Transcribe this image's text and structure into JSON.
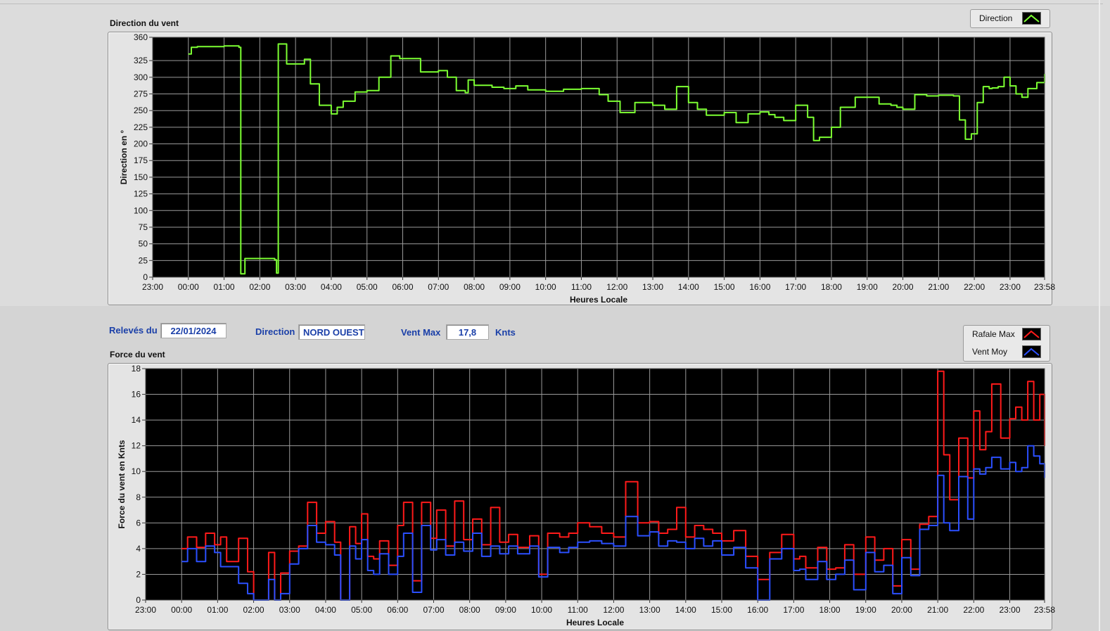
{
  "direction_panel": {
    "title": "Direction du vent",
    "legend": [
      {
        "label": "Direction",
        "color": "#7cff32"
      }
    ]
  },
  "controls": {
    "date_label": "Relevés du",
    "date_value": "22/01/2024",
    "direction_label": "Direction",
    "direction_value": "NORD OUEST",
    "vmax_label": "Vent Max",
    "vmax_value": "17,8",
    "vmax_unit": "Knts"
  },
  "force_panel": {
    "title": "Force du vent",
    "legend": [
      {
        "label": "Rafale Max",
        "color": "#ff1a1a"
      },
      {
        "label": "Vent Moy",
        "color": "#2b4fff"
      }
    ]
  },
  "chart_data": [
    {
      "type": "line",
      "title": "",
      "xlabel": "Heures Locale",
      "ylabel": "Direction en °",
      "x_ticks": [
        "23:00",
        "00:00",
        "01:00",
        "02:00",
        "03:00",
        "04:00",
        "05:00",
        "06:00",
        "07:00",
        "08:00",
        "09:00",
        "10:00",
        "11:00",
        "12:00",
        "13:00",
        "14:00",
        "15:00",
        "16:00",
        "17:00",
        "18:00",
        "19:00",
        "20:00",
        "21:00",
        "22:00",
        "23:00",
        "23:58"
      ],
      "y_ticks": [
        0,
        25,
        50,
        75,
        100,
        125,
        150,
        175,
        200,
        225,
        250,
        275,
        300,
        325,
        360
      ],
      "ylim": [
        0,
        360
      ],
      "grid": true,
      "legend_position": "top-right",
      "series": [
        {
          "name": "Direction",
          "color": "#7cff32",
          "x": [
            "00:00",
            "00:05",
            "00:15",
            "01:00",
            "01:25",
            "01:28",
            "01:35",
            "02:25",
            "02:28",
            "02:31",
            "02:45",
            "03:10",
            "03:15",
            "03:25",
            "03:40",
            "04:00",
            "04:10",
            "04:20",
            "04:40",
            "05:00",
            "05:15",
            "05:20",
            "05:40",
            "05:55",
            "06:30",
            "07:00",
            "07:15",
            "07:30",
            "07:45",
            "07:50",
            "08:00",
            "08:30",
            "08:50",
            "09:10",
            "09:30",
            "10:00",
            "10:30",
            "11:00",
            "11:30",
            "11:45",
            "12:05",
            "12:30",
            "13:00",
            "13:20",
            "13:40",
            "14:00",
            "14:15",
            "14:30",
            "15:00",
            "15:20",
            "15:40",
            "16:00",
            "16:15",
            "16:25",
            "16:40",
            "17:00",
            "17:15",
            "17:20",
            "17:30",
            "17:40",
            "17:45",
            "17:55",
            "18:00",
            "18:15",
            "18:40",
            "19:20",
            "19:30",
            "19:40",
            "19:50",
            "20:00",
            "20:20",
            "20:40",
            "21:00",
            "21:20",
            "21:25",
            "21:35",
            "21:45",
            "21:55",
            "22:05",
            "22:15",
            "22:25",
            "22:30",
            "22:40",
            "22:50",
            "23:00",
            "23:10",
            "23:20",
            "23:30",
            "23:45",
            "23:58"
          ],
          "values": [
            335,
            345,
            346,
            347,
            345,
            5,
            28,
            26,
            6,
            350,
            320,
            320,
            327,
            290,
            258,
            245,
            255,
            264,
            278,
            280,
            280,
            300,
            332,
            328,
            308,
            310,
            300,
            280,
            277,
            296,
            288,
            285,
            283,
            287,
            281,
            279,
            282,
            283,
            274,
            264,
            247,
            262,
            258,
            252,
            286,
            262,
            252,
            243,
            247,
            232,
            245,
            248,
            244,
            240,
            235,
            258,
            258,
            240,
            205,
            210,
            210,
            210,
            225,
            255,
            270,
            260,
            260,
            258,
            255,
            252,
            274,
            272,
            273,
            273,
            272,
            236,
            207,
            215,
            262,
            286,
            283,
            284,
            286,
            300,
            287,
            275,
            270,
            283,
            292,
            305
          ]
        }
      ]
    },
    {
      "type": "line",
      "title": "",
      "xlabel": "Heures Locale",
      "ylabel": "Force du vent en Knts",
      "x_ticks": [
        "23:00",
        "00:00",
        "01:00",
        "02:00",
        "03:00",
        "04:00",
        "05:00",
        "06:00",
        "07:00",
        "08:00",
        "09:00",
        "10:00",
        "11:00",
        "12:00",
        "13:00",
        "14:00",
        "15:00",
        "16:00",
        "17:00",
        "18:00",
        "19:00",
        "20:00",
        "21:00",
        "22:00",
        "23:00",
        "23:58"
      ],
      "y_ticks": [
        0,
        2,
        4,
        6,
        8,
        10,
        12,
        14,
        16,
        18
      ],
      "ylim": [
        0,
        18
      ],
      "grid": true,
      "legend_position": "top-right",
      "series": [
        {
          "name": "Rafale Max",
          "color": "#ff1a1a",
          "x": [
            "00:00",
            "00:10",
            "00:25",
            "00:40",
            "00:55",
            "01:05",
            "01:15",
            "01:35",
            "01:50",
            "02:00",
            "02:10",
            "02:25",
            "02:35",
            "02:45",
            "03:00",
            "03:15",
            "03:30",
            "03:45",
            "04:00",
            "04:15",
            "04:25",
            "04:40",
            "04:50",
            "05:00",
            "05:10",
            "05:20",
            "05:30",
            "05:45",
            "06:00",
            "06:10",
            "06:25",
            "06:40",
            "06:55",
            "07:05",
            "07:20",
            "07:35",
            "07:50",
            "08:05",
            "08:20",
            "08:35",
            "08:50",
            "09:05",
            "09:20",
            "09:40",
            "09:55",
            "10:10",
            "10:30",
            "10:45",
            "11:00",
            "11:20",
            "11:40",
            "12:00",
            "12:20",
            "12:40",
            "13:00",
            "13:15",
            "13:30",
            "13:45",
            "14:00",
            "14:15",
            "14:30",
            "14:45",
            "15:00",
            "15:20",
            "15:40",
            "16:00",
            "16:20",
            "16:40",
            "17:00",
            "17:10",
            "17:20",
            "17:40",
            "17:55",
            "18:10",
            "18:25",
            "18:40",
            "19:00",
            "19:15",
            "19:30",
            "19:45",
            "20:00",
            "20:15",
            "20:30",
            "20:45",
            "21:00",
            "21:10",
            "21:20",
            "21:35",
            "21:50",
            "22:00",
            "22:10",
            "22:20",
            "22:30",
            "22:45",
            "23:00",
            "23:10",
            "23:20",
            "23:30",
            "23:40",
            "23:50",
            "23:58"
          ],
          "values": [
            4.0,
            4.9,
            4.1,
            5.2,
            4.3,
            4.9,
            3.0,
            4.8,
            2.2,
            0.0,
            0.0,
            3.7,
            0.0,
            2.1,
            3.8,
            4.2,
            7.6,
            5.2,
            6.1,
            4.5,
            0.0,
            5.7,
            4.4,
            6.7,
            3.4,
            3.2,
            4.6,
            2.7,
            5.8,
            7.6,
            1.5,
            7.6,
            4.8,
            7.0,
            4.2,
            7.7,
            4.7,
            6.3,
            4.3,
            7.2,
            4.5,
            5.1,
            4.1,
            5.0,
            2.0,
            5.2,
            4.9,
            5.2,
            6.0,
            5.7,
            5.2,
            4.9,
            9.2,
            6.0,
            6.1,
            5.2,
            5.5,
            7.2,
            4.9,
            5.8,
            5.5,
            5.2,
            4.6,
            5.4,
            3.4,
            1.6,
            3.7,
            5.1,
            3.2,
            3.4,
            2.5,
            4.1,
            2.4,
            2.5,
            4.3,
            2.0,
            4.9,
            3.1,
            4.0,
            1.1,
            4.7,
            2.4,
            5.9,
            6.5,
            17.8,
            11.3,
            7.8,
            12.6,
            9.5,
            14.7,
            11.7,
            13.1,
            16.8,
            12.6,
            14.1,
            15.0,
            14.0,
            17.0,
            14.0,
            16.0,
            12.0
          ]
        },
        {
          "name": "Vent Moy",
          "color": "#2b4fff",
          "x": [
            "00:00",
            "00:10",
            "00:25",
            "00:40",
            "00:55",
            "01:05",
            "01:15",
            "01:35",
            "01:50",
            "02:00",
            "02:10",
            "02:25",
            "02:35",
            "02:45",
            "03:00",
            "03:15",
            "03:30",
            "03:45",
            "04:00",
            "04:15",
            "04:25",
            "04:40",
            "04:50",
            "05:00",
            "05:10",
            "05:20",
            "05:30",
            "05:45",
            "06:00",
            "06:10",
            "06:25",
            "06:40",
            "06:55",
            "07:05",
            "07:20",
            "07:35",
            "07:50",
            "08:05",
            "08:20",
            "08:35",
            "08:50",
            "09:05",
            "09:20",
            "09:40",
            "09:55",
            "10:10",
            "10:30",
            "10:45",
            "11:00",
            "11:20",
            "11:40",
            "12:00",
            "12:20",
            "12:40",
            "13:00",
            "13:15",
            "13:30",
            "13:45",
            "14:00",
            "14:15",
            "14:30",
            "14:45",
            "15:00",
            "15:20",
            "15:40",
            "16:00",
            "16:20",
            "16:40",
            "17:00",
            "17:10",
            "17:20",
            "17:40",
            "17:55",
            "18:10",
            "18:25",
            "18:40",
            "19:00",
            "19:15",
            "19:30",
            "19:45",
            "20:00",
            "20:15",
            "20:30",
            "20:45",
            "21:00",
            "21:10",
            "21:20",
            "21:35",
            "21:50",
            "22:00",
            "22:10",
            "22:20",
            "22:30",
            "22:45",
            "23:00",
            "23:10",
            "23:20",
            "23:30",
            "23:40",
            "23:50",
            "23:58"
          ],
          "values": [
            3.0,
            4.0,
            3.0,
            4.2,
            3.7,
            2.6,
            2.6,
            1.3,
            0.5,
            0.0,
            0.0,
            1.6,
            0.0,
            0.5,
            2.8,
            4.0,
            5.8,
            4.5,
            4.3,
            3.5,
            0.0,
            4.2,
            3.2,
            4.7,
            2.3,
            2.0,
            3.6,
            2.0,
            3.4,
            5.2,
            0.6,
            5.8,
            3.9,
            4.7,
            3.5,
            4.5,
            3.8,
            5.2,
            3.4,
            4.2,
            3.6,
            4.2,
            3.6,
            4.2,
            1.8,
            4.1,
            3.7,
            4.1,
            4.5,
            4.6,
            4.4,
            4.2,
            6.5,
            5.0,
            5.3,
            4.2,
            4.6,
            4.5,
            4.0,
            4.8,
            4.2,
            4.6,
            3.5,
            4.1,
            2.5,
            0.0,
            3.2,
            4.0,
            2.3,
            2.4,
            1.6,
            3.0,
            1.6,
            2.0,
            3.1,
            0.8,
            3.7,
            2.2,
            2.7,
            0.5,
            3.3,
            1.9,
            5.5,
            5.8,
            9.7,
            6.0,
            5.4,
            9.6,
            6.3,
            10.2,
            9.8,
            10.3,
            11.1,
            10.2,
            10.7,
            10.0,
            10.3,
            12.0,
            11.2,
            10.6,
            9.5
          ]
        }
      ]
    }
  ]
}
